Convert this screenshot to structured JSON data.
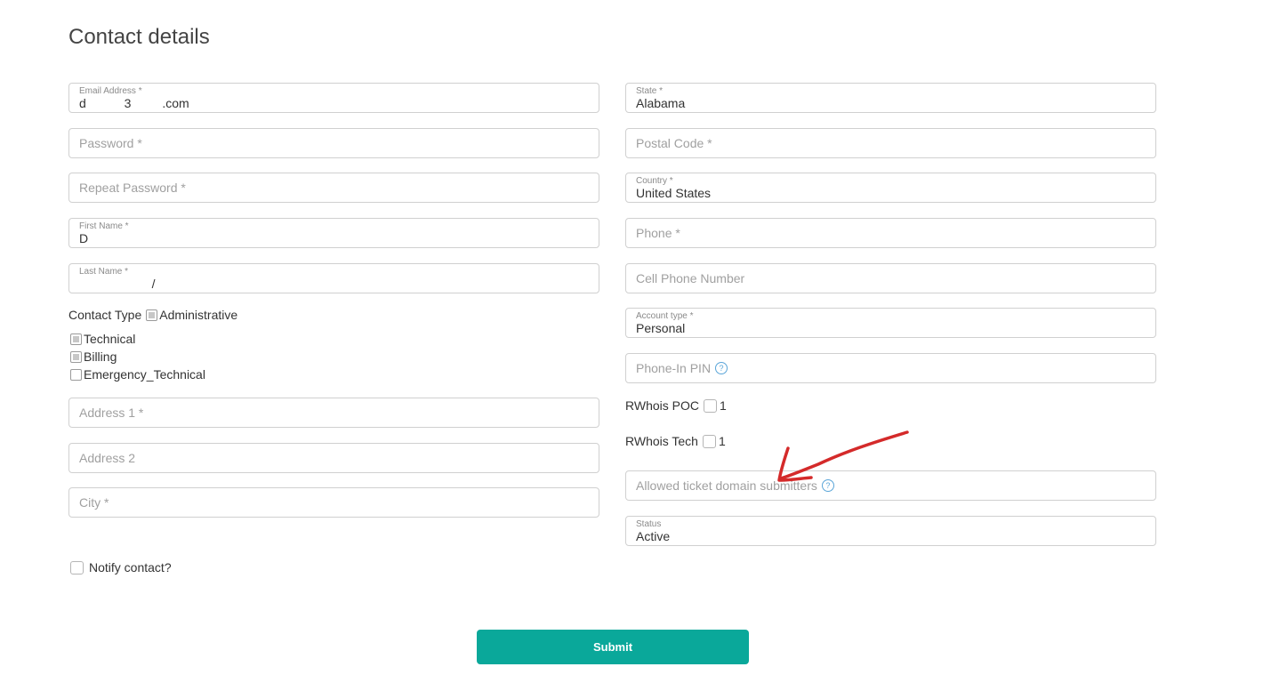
{
  "page": {
    "title": "Contact details"
  },
  "left_fields": {
    "email": {
      "label": "Email Address *",
      "value": "d           3         .com"
    },
    "password": {
      "placeholder": "Password *"
    },
    "repeat_password": {
      "placeholder": "Repeat Password *"
    },
    "first_name": {
      "label": "First Name *",
      "value": "D"
    },
    "last_name": {
      "label": "Last Name *",
      "value": "                     /"
    },
    "address1": {
      "placeholder": "Address 1 *"
    },
    "address2": {
      "placeholder": "Address 2"
    },
    "city": {
      "placeholder": "City *"
    }
  },
  "contact_type": {
    "label": "Contact Type",
    "options": [
      {
        "label": "Administrative",
        "checked": true
      },
      {
        "label": "Technical",
        "checked": true
      },
      {
        "label": "Billing",
        "checked": true
      },
      {
        "label": "Emergency_Technical",
        "checked": false
      }
    ]
  },
  "notify": {
    "label": "Notify contact?",
    "checked": false
  },
  "right_fields": {
    "state": {
      "label": "State *",
      "value": "Alabama"
    },
    "postal_code": {
      "placeholder": "Postal Code *"
    },
    "country": {
      "label": "Country *",
      "value": "United States"
    },
    "phone": {
      "placeholder": "Phone *"
    },
    "cell_phone": {
      "placeholder": "Cell Phone Number"
    },
    "account_type": {
      "label": "Account type *",
      "value": "Personal"
    },
    "phone_pin": {
      "placeholder": "Phone-In PIN"
    },
    "allowed_submitters": {
      "placeholder": "Allowed ticket domain submitters"
    },
    "status": {
      "label": "Status",
      "value": "Active"
    }
  },
  "rwhois_poc": {
    "label": "RWhois POC",
    "value_label": "1",
    "checked": false
  },
  "rwhois_tech": {
    "label": "RWhois Tech",
    "value_label": "1",
    "checked": false
  },
  "help_icon_glyph": "?",
  "submit": {
    "label": "Submit"
  },
  "colors": {
    "accent": "#0aa89a",
    "annotation": "#d42a2a",
    "help_icon": "#5aa5d8"
  }
}
